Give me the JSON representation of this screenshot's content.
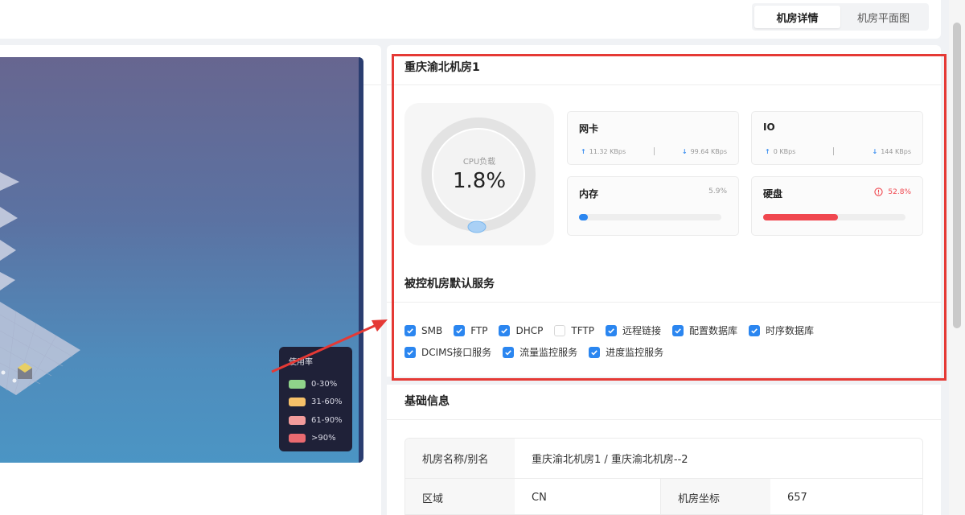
{
  "tabs": [
    {
      "label": "机房详情",
      "active": true
    },
    {
      "label": "机房平面图",
      "active": false
    }
  ],
  "viz": {
    "legend": {
      "title": "使用率",
      "items": [
        {
          "label": "0-30%",
          "color": "#8fd48a"
        },
        {
          "label": "31-60%",
          "color": "#f6c169"
        },
        {
          "label": "61-90%",
          "color": "#f29b9b"
        },
        {
          "label": ">90%",
          "color": "#ea6a70"
        }
      ]
    }
  },
  "room": {
    "title": "重庆渝北机房1",
    "cpu": {
      "label": "CPU负载",
      "value": "1.8%"
    },
    "network": {
      "title": "网卡",
      "up": "11.32 KBps",
      "down": "99.64 KBps"
    },
    "io": {
      "title": "IO",
      "up": "0 KBps",
      "down": "144 KBps"
    },
    "memory": {
      "title": "内存",
      "value": "5.9%",
      "fraction": 0.059,
      "color": "#2b86f0"
    },
    "disk": {
      "title": "硬盘",
      "value": "52.8%",
      "fraction": 0.528,
      "color": "#f0474f"
    }
  },
  "services": {
    "title": "被控机房默认服务",
    "rows": [
      [
        {
          "label": "SMB",
          "checked": true
        },
        {
          "label": "FTP",
          "checked": true
        },
        {
          "label": "DHCP",
          "checked": true
        },
        {
          "label": "TFTP",
          "checked": false
        },
        {
          "label": "远程链接",
          "checked": true
        },
        {
          "label": "配置数据库",
          "checked": true
        },
        {
          "label": "时序数据库",
          "checked": true
        }
      ],
      [
        {
          "label": "DCIMS接口服务",
          "checked": true
        },
        {
          "label": "流量监控服务",
          "checked": true
        },
        {
          "label": "进度监控服务",
          "checked": true
        }
      ]
    ]
  },
  "basic_info": {
    "title": "基础信息",
    "name_label": "机房名称/别名",
    "name_value": "重庆渝北机房1 / 重庆渝北机房--2",
    "region_label": "区域",
    "region_value": "CN",
    "coord_label": "机房坐标",
    "coord_value": "657"
  },
  "colors": {
    "accent": "#2b86f0",
    "highlight": "#e53935"
  }
}
